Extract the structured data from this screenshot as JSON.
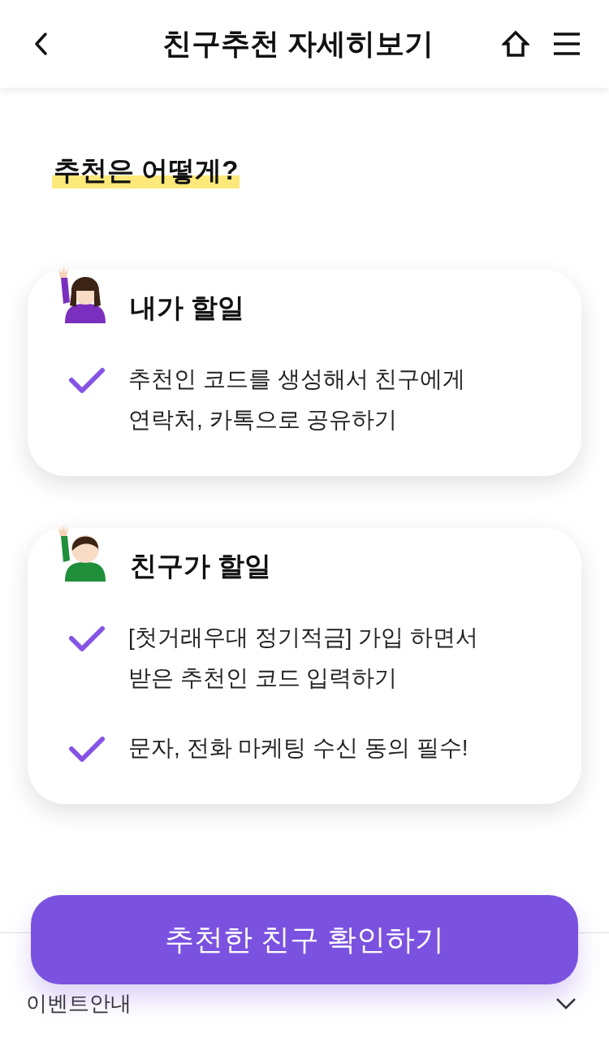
{
  "header": {
    "title": "친구추천 자세히보기"
  },
  "section_title": "추천은 어떻게?",
  "cards": [
    {
      "avatar": {
        "kind": "girl"
      },
      "title": "내가 할일",
      "items": [
        "추천인 코드를 생성해서 친구에게\n연락처, 카톡으로 공유하기"
      ]
    },
    {
      "avatar": {
        "kind": "boy"
      },
      "title": "친구가 할일",
      "items": [
        "[첫거래우대 정기적금] 가입 하면서\n받은 추천인 코드 입력하기",
        "문자, 전화 마케팅 수신 동의 필수!"
      ]
    }
  ],
  "accordion": {
    "label": "이벤트안내",
    "expanded": false
  },
  "cta_button": "추천한 친구 확인하기"
}
